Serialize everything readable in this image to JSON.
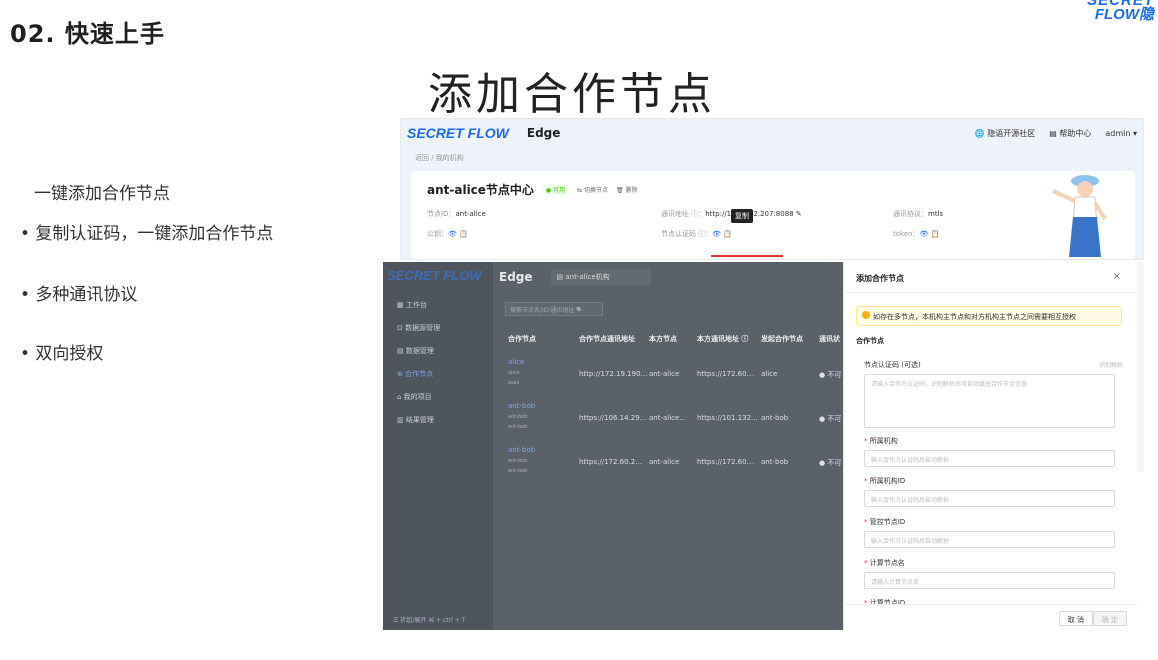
{
  "section_title": "02. 快速上手",
  "corner_logo": {
    "line1": "SECRET",
    "line2": "FLOW隐"
  },
  "slide_title": "添加合作节点",
  "bullets": {
    "intro": "一键添加合作节点",
    "items": [
      "• 复制认证码，一键添加合作节点",
      "• 多种通讯协议",
      "• 双向授权"
    ]
  },
  "shot1": {
    "logo": "SECRET FLOW",
    "app": "Edge",
    "top_links": [
      "🌐 隐语开源社区",
      "▤ 帮助中心",
      "admin ▾"
    ],
    "breadcrumb": "返回 / 我的机构",
    "node_title": "ant-alice节点中心",
    "status": "● 可用",
    "switch": "⇆ 切换节点",
    "delete": "🗑 删除",
    "node_id_label": "节点ID：",
    "node_id": "ant-alice",
    "pubkey_label": "公钥：",
    "addr_label": "通讯地址 ⓘ：",
    "addr_value": "http://172.60.2.207:8088 ✎",
    "cert_label": "节点认证码 ⓘ：",
    "tooltip": "复制",
    "protocol_label": "通讯协议：",
    "protocol": "mtls",
    "token_label": "token：",
    "icons": "👁 📋"
  },
  "shot2": {
    "logo": "SECRET FLOW",
    "app": "Edge",
    "org": "▤ ant-alice机构",
    "menu": [
      "▦ 工作台",
      "⊡ 数据源管理",
      "▤ 数据管理",
      "⊕ 合作节点",
      "⌂ 我的项目",
      "▥ 结果管理"
    ],
    "footer": "☰    折起/展开 ⌘ + ctrl + T",
    "search": "搜索节点名/ID/通讯地址  🔍",
    "headers": [
      "合作节点",
      "合作节点通讯地址",
      "本方节点",
      "本方通讯地址 ⓘ",
      "发起合作节点",
      "通讯状"
    ],
    "rows": [
      {
        "name": "alice",
        "sub1": "alice",
        "sub2": "asas",
        "addr": "http://172.19.190...",
        "self": "ant-alice",
        "self_addr": "https://172.60...",
        "initiator": "alice",
        "status": "● 不可"
      },
      {
        "name": "ant-bob",
        "sub1": "ant-bob",
        "sub2": "ant-bob",
        "addr": "https://106.14.29...",
        "self": "ant-alice...",
        "self_addr": "https://101.132...",
        "initiator": "ant-bob",
        "status": "● 不可"
      },
      {
        "name": "ant-bob",
        "sub1": "ant-bob",
        "sub2": "ant-bob",
        "addr": "https://172.60.2...",
        "self": "ant-alice",
        "self_addr": "https://172.60...",
        "initiator": "ant-bob",
        "status": "● 不可"
      }
    ]
  },
  "drawer": {
    "title": "添加合作节点",
    "close": "×",
    "alert": "如存在多节点，本机构主节点和对方机构主节点之间需要相互授权",
    "section": "合作节点",
    "cert_label": "节点认证码 (可选)",
    "cert_hint": "识别解析",
    "cert_placeholder": "请输入合作方认证码，识别解析后可自动填充合作节点信息",
    "fields": [
      {
        "label": "所属机构",
        "placeholder": "输入合作方认证码后自动解析"
      },
      {
        "label": "所属机构ID",
        "placeholder": "输入合作方认证码后自动解析"
      },
      {
        "label": "管控节点ID",
        "placeholder": "输入合作方认证码后自动解析"
      },
      {
        "label": "计算节点名",
        "placeholder": "请输入计算节点名"
      }
    ],
    "last_label": "计算节点ID",
    "cancel": "取 消",
    "ok": "确 定"
  }
}
